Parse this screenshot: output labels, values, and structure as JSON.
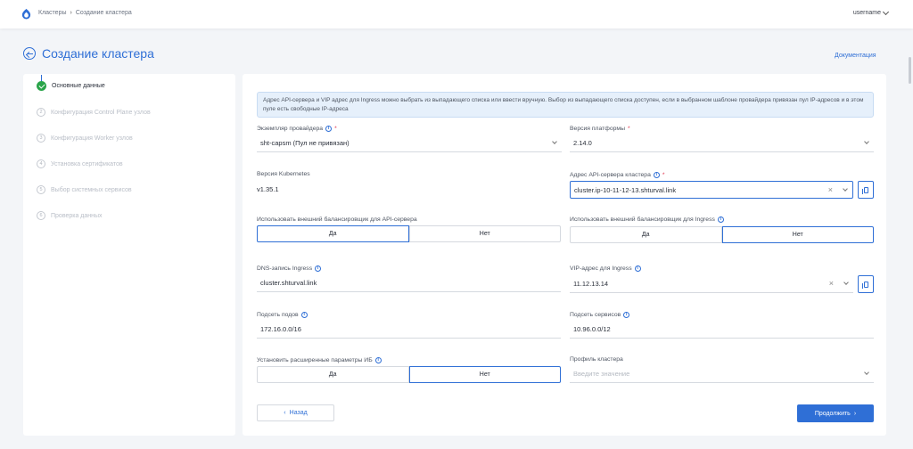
{
  "header": {
    "breadcrumbs": [
      "Кластеры",
      "Создание кластера"
    ],
    "separator": "›",
    "username": "username"
  },
  "page": {
    "title": "Создание кластера",
    "docs_link": "Документация"
  },
  "steps": [
    {
      "num": "1",
      "label": "Основные данные",
      "state": "done"
    },
    {
      "num": "2",
      "label": "Конфигурация Control Plane узлов",
      "state": "pending"
    },
    {
      "num": "3",
      "label": "Конфигурация Worker узлов",
      "state": "pending"
    },
    {
      "num": "4",
      "label": "Установка сертификатов",
      "state": "pending"
    },
    {
      "num": "5",
      "label": "Выбор системных сервисов",
      "state": "pending"
    },
    {
      "num": "6",
      "label": "Проверка данных",
      "state": "pending"
    }
  ],
  "info_banner": "Адрес API-сервера и VIP адрес для Ingress можно выбрать из выпадающего списка или ввести вручную. Выбор из выпадающего списка доступен, если в выбранном шаблоне провайдера привязан пул IP-адресов и в этом пуле есть свободные IP-адреса",
  "form": {
    "provider_instance": {
      "label": "Экземпляр провайдера",
      "value": "sht-capsm (Пул не привязан)"
    },
    "platform_version": {
      "label": "Версия платформы",
      "value": "2.14.0"
    },
    "kubernetes_version": {
      "label": "Версия Kubernetes",
      "value": "v1.35.1"
    },
    "api_server_address": {
      "label": "Адрес API-сервера кластера",
      "value": "cluster.ip-10-11-12-13.shturval.link"
    },
    "external_lb_api": {
      "label": "Использовать внешний балансировщик для API-сервера",
      "options": [
        "Да",
        "Нет"
      ],
      "selected": "Да"
    },
    "external_lb_ingress": {
      "label": "Использовать внешний балансировщик для Ingress",
      "options": [
        "Да",
        "Нет"
      ],
      "selected": "Нет"
    },
    "dns_ingress": {
      "label": "DNS-запись Ingress",
      "value": "cluster.shturval.link"
    },
    "vip_ingress": {
      "label": "VIP-адрес для Ingress",
      "value": "11.12.13.14"
    },
    "pod_subnet": {
      "label": "Подсеть подов",
      "value": "172.16.0.0/16"
    },
    "service_subnet": {
      "label": "Подсеть сервисов",
      "value": "10.96.0.0/12"
    },
    "advanced_params": {
      "label": "Установить расширенные параметры ИБ",
      "options": [
        "Да",
        "Нет"
      ],
      "selected": "Нет"
    },
    "cluster_profile": {
      "label": "Профиль кластера",
      "placeholder": "Введите значение"
    }
  },
  "actions": {
    "back": "Назад",
    "next": "Продолжить"
  },
  "colors": {
    "accent": "#2f6fd6",
    "success": "#2aa44a",
    "required": "#e0324b",
    "info_bg": "#e6f0fb"
  }
}
